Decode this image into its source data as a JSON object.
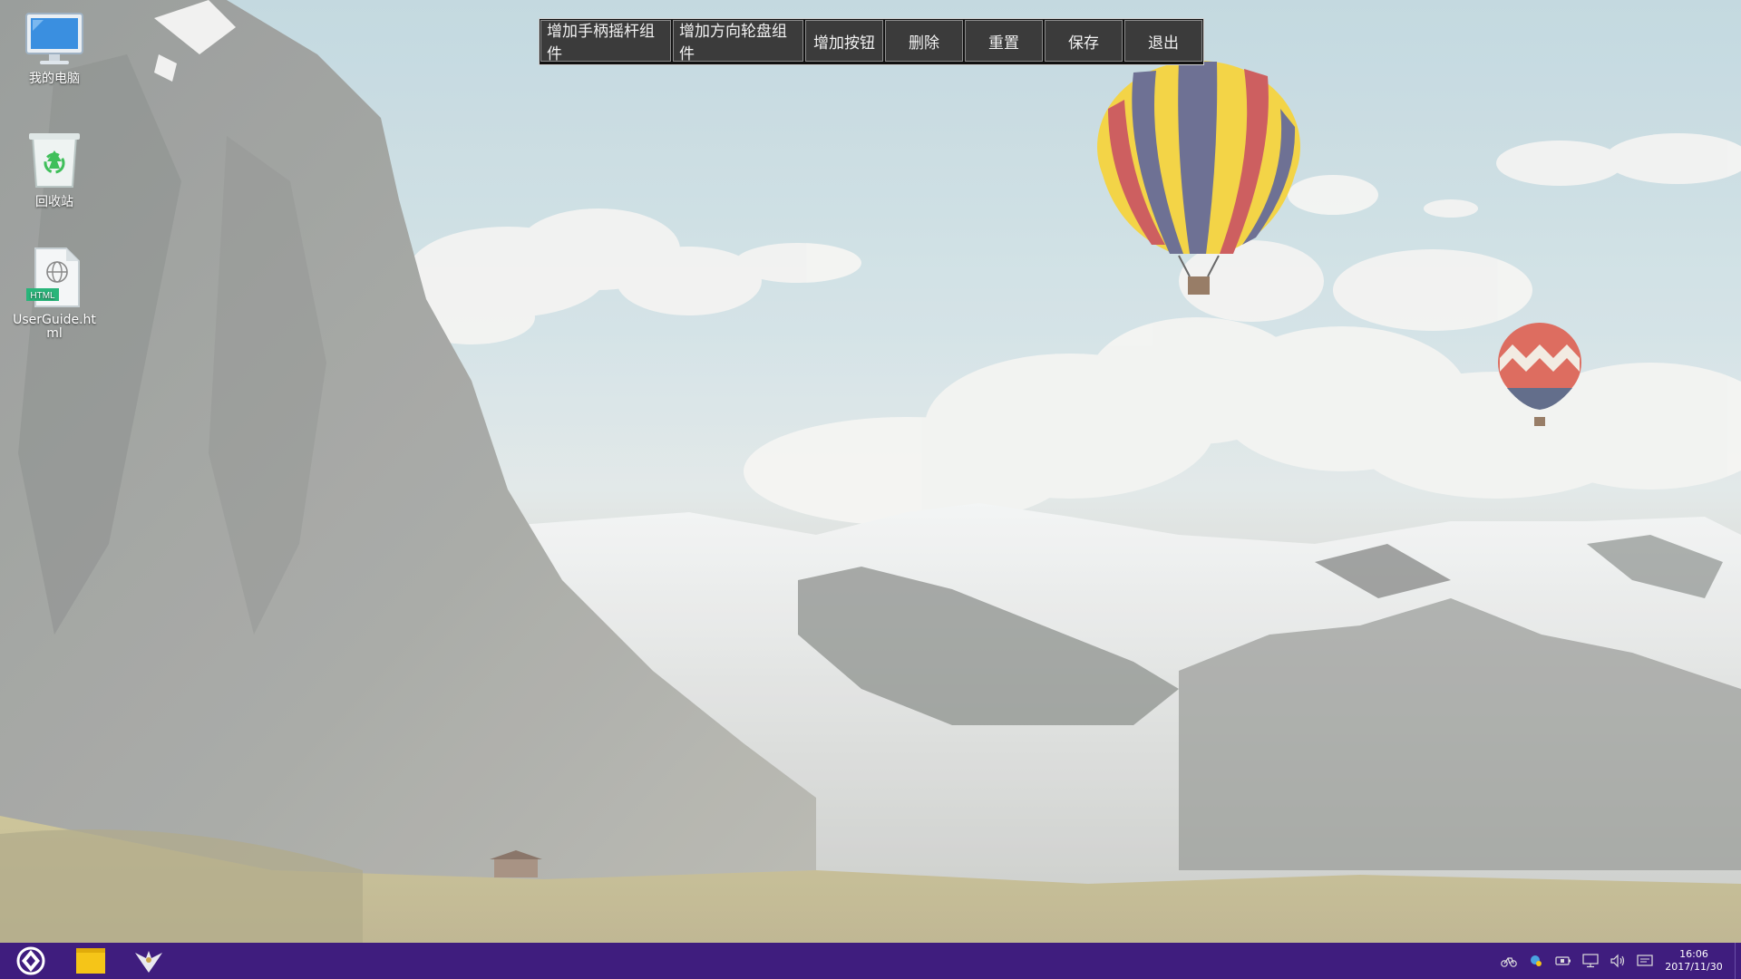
{
  "desktop": {
    "icons": [
      {
        "label": "我的电脑",
        "icon": "computer-icon"
      },
      {
        "label": "回收站",
        "icon": "recycle-bin-icon"
      },
      {
        "label": "UserGuide.html",
        "icon": "html-file-icon",
        "badge": "HTML"
      }
    ]
  },
  "toolbar": {
    "buttons": [
      {
        "label": "增加手柄摇杆组件"
      },
      {
        "label": "增加方向轮盘组件"
      },
      {
        "label": "增加按钮"
      },
      {
        "label": "删除"
      },
      {
        "label": "重置"
      },
      {
        "label": "保存"
      },
      {
        "label": "退出"
      }
    ]
  },
  "taskbar": {
    "start_icon": "start-menu-icon",
    "apps": [
      {
        "icon": "file-manager-icon"
      },
      {
        "icon": "eagle-app-icon"
      }
    ],
    "tray": [
      {
        "icon": "bicycle-icon"
      },
      {
        "icon": "app-status-icon"
      },
      {
        "icon": "battery-icon"
      },
      {
        "icon": "display-icon"
      },
      {
        "icon": "volume-icon"
      },
      {
        "icon": "notification-icon"
      }
    ],
    "time": "16:06",
    "date": "2017/11/30"
  },
  "colors": {
    "taskbar": "#3f1d7e",
    "toolbar_button": "#3b3b3b",
    "file_manager_yellow": "#f5c518"
  }
}
